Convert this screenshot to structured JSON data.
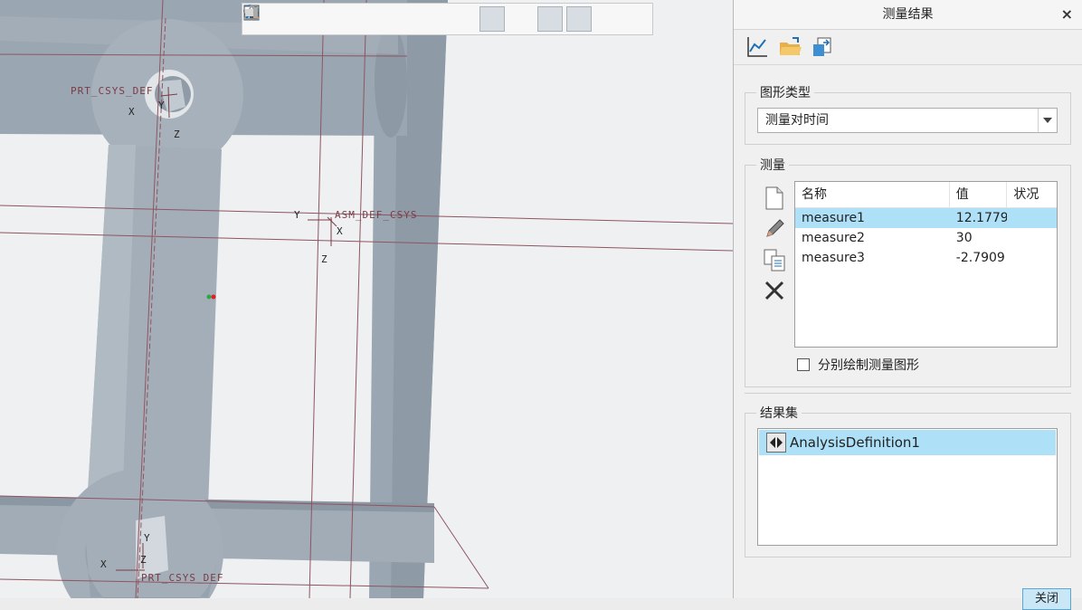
{
  "viewport": {
    "labels": {
      "csys_top": "PRT_CSYS_DEF",
      "csys_center": "ASM_DEF_CSYS",
      "csys_bottom": "PRT_CSYS_DEF",
      "axis_x": "X",
      "axis_y": "Y",
      "axis_z": "Z"
    },
    "colors": {
      "part": "#a9b4be",
      "part_dark": "#8f9ba6",
      "datum": "#7a3c46",
      "background": "#eef0f2"
    }
  },
  "toolbar": {
    "icons": [
      "refit-icon",
      "zoom-in-icon",
      "zoom-out-icon",
      "reorient-icon",
      "saved-views-icon",
      "display-style-icon",
      "section-icon",
      "snapshot-icon",
      "perspective-icon",
      "datum-display-icon",
      "annotation-display-icon",
      "spin-center-icon",
      "appearance-icon",
      "hidden-icon"
    ]
  },
  "panel": {
    "title": "测量结果",
    "close": "×",
    "graph_type": {
      "legend": "图形类型",
      "selected": "测量对时间"
    },
    "measures": {
      "legend": "测量",
      "columns": [
        "名称",
        "值",
        "状况"
      ],
      "rows": [
        {
          "name": "measure1",
          "value": "12.1779",
          "status": ""
        },
        {
          "name": "measure2",
          "value": "30",
          "status": ""
        },
        {
          "name": "measure3",
          "value": "-2.7909",
          "status": ""
        }
      ],
      "separate_graph_label": "分别绘制测量图形"
    },
    "result_sets": {
      "legend": "结果集",
      "items": [
        "AnalysisDefinition1"
      ]
    },
    "close_button": "关闭"
  }
}
